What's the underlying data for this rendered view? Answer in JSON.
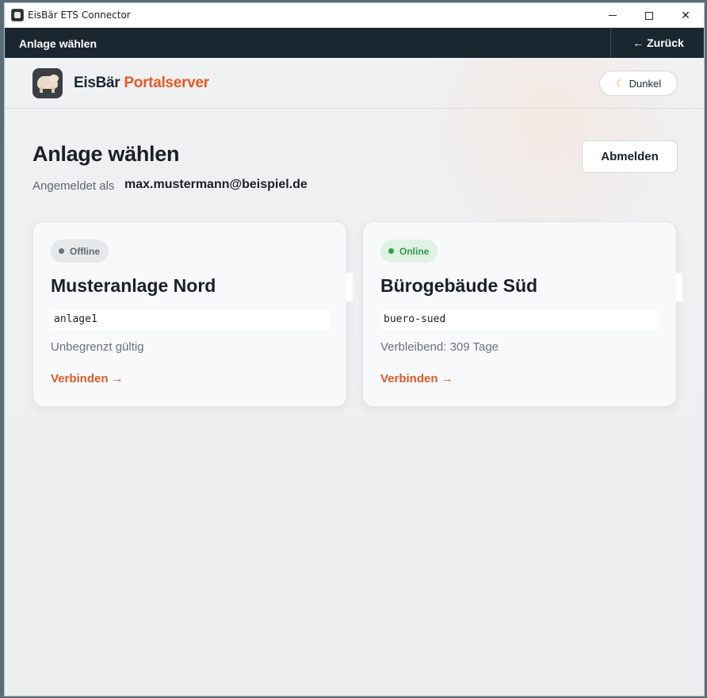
{
  "window": {
    "title": "EisBär ETS Connector"
  },
  "topbar": {
    "title": "Anlage wählen",
    "back_label": "← Zurück"
  },
  "header": {
    "brand_main": "EisBär",
    "brand_accent": "Portalserver",
    "theme_label": "Dunkel",
    "theme_icon": "moon-icon"
  },
  "page": {
    "title": "Anlage wählen",
    "logged_in_prefix": "Angemeldet als",
    "email": "max.mustermann@beispiel.de",
    "logout_label": "Abmelden"
  },
  "cards": [
    {
      "status": "Offline",
      "name": "Musteranlage Nord",
      "id": "anlage1",
      "validity": "Unbegrenzt gültig",
      "action": "Verbinden →"
    },
    {
      "status": "Online",
      "name": "Bürogebäude Süd",
      "id": "buero-sued",
      "validity": "Verbleibend: 309 Tage",
      "action": "Verbinden →"
    }
  ],
  "colors": {
    "accent": "#e45a26",
    "topbar": "#1b2730",
    "online": "#2ea14e",
    "offline": "#6a737b"
  }
}
